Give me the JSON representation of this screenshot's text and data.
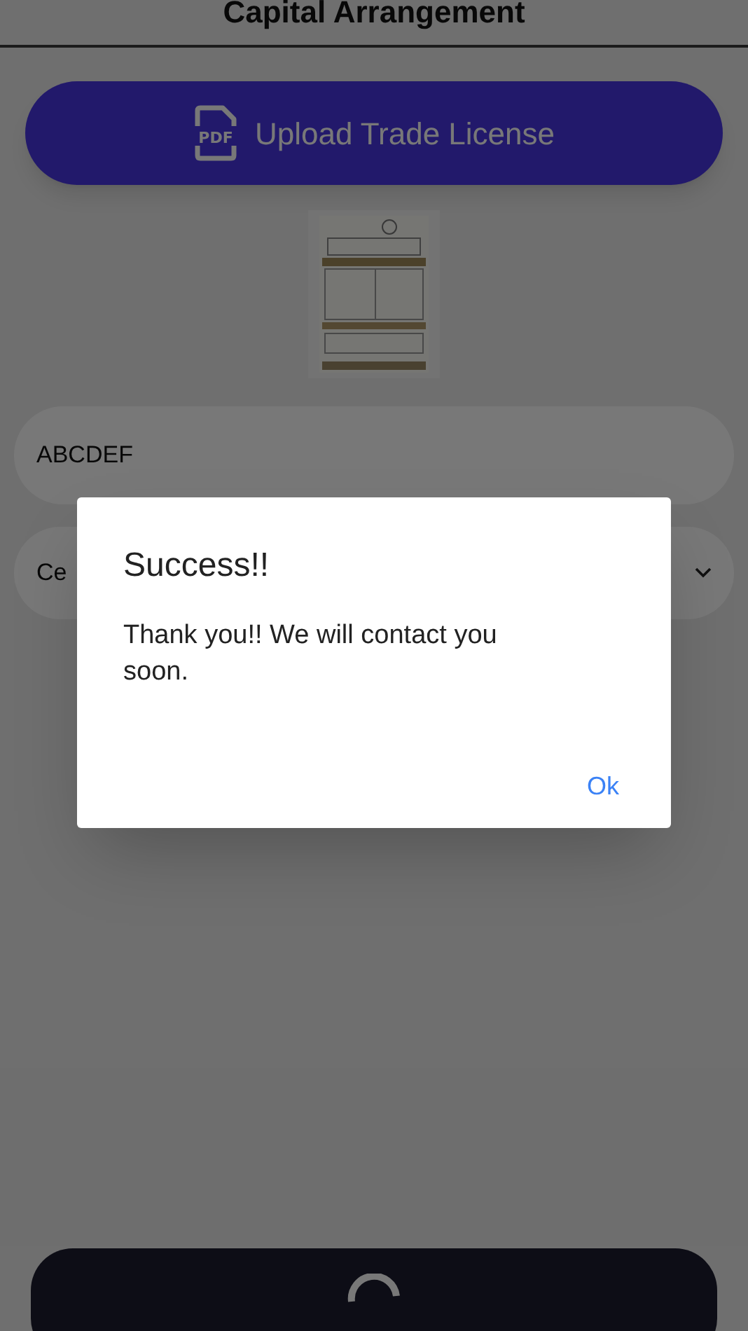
{
  "header": {
    "title": "Capital Arrangement"
  },
  "upload_button": {
    "icon_text": "PDF",
    "label": "Upload Trade License"
  },
  "fields": [
    {
      "kind": "text",
      "value": "ABCDEF"
    },
    {
      "kind": "dropdown",
      "value": "Ce"
    }
  ],
  "dialog": {
    "title": "Success!!",
    "message": "Thank you!! We will contact you soon.",
    "buttons": [
      "Ok"
    ]
  },
  "submit_button": {
    "loading": true
  }
}
